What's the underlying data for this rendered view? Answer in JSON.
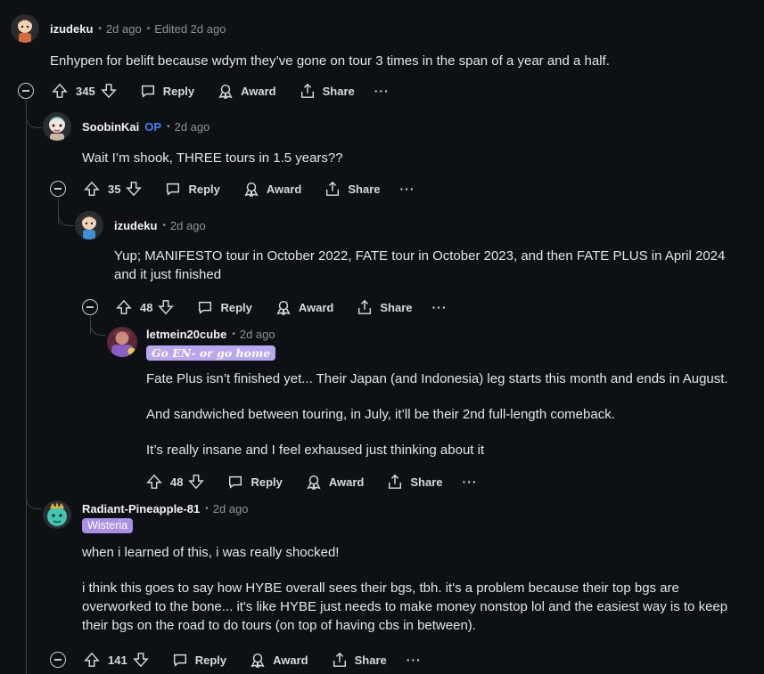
{
  "comments": [
    {
      "username": "izudeku",
      "time": "2d ago",
      "edited": "Edited 2d ago",
      "body": [
        "Enhypen for belift because wdym they’ve gone on tour 3 times in the span of a year and a half."
      ],
      "votes": "345"
    },
    {
      "username": "SoobinKai",
      "op_badge": "OP",
      "time": "2d ago",
      "body": [
        "Wait I’m shook, THREE tours in 1.5 years??"
      ],
      "votes": "35"
    },
    {
      "username": "izudeku",
      "time": "2d ago",
      "body": [
        "Yup; MANIFESTO tour in October 2022, FATE tour in October 2023, and then FATE PLUS in April 2024 and it just finished"
      ],
      "votes": "48"
    },
    {
      "username": "letmein20cube",
      "time": "2d ago",
      "flair": "Go EN- or go home",
      "body": [
        "Fate Plus isn’t finished yet... Their Japan (and Indonesia) leg starts this month and ends in August.",
        "And sandwiched between touring, in July, it’ll be their 2nd full-length comeback.",
        "It’s really insane and I feel exhaused just thinking about it"
      ],
      "votes": "48"
    },
    {
      "username": "Radiant-Pineapple-81",
      "time": "2d ago",
      "flair": "Wisteria",
      "body": [
        "when i learned of this, i was really shocked!",
        "i think this goes to say how HYBE overall sees their bgs, tbh. it's a problem because their top bgs are overworked to the bone... it's like HYBE just needs to make money nonstop lol and the easiest way is to keep their bgs on the road to do tours (on top of having cbs in between)."
      ],
      "votes": "141"
    }
  ],
  "actions": {
    "reply": "Reply",
    "award": "Award",
    "share": "Share",
    "more": "···"
  },
  "icons": {
    "upvote": "upvote-icon",
    "downvote": "downvote-icon",
    "reply": "reply-icon",
    "award": "award-icon",
    "share": "share-icon",
    "collapse": "collapse-icon"
  },
  "colors": {
    "background": "#0e1113",
    "op": "#3b82f6",
    "flair_go_en": "#b9a5f0",
    "flair_wisteria": "#a98fe8"
  }
}
